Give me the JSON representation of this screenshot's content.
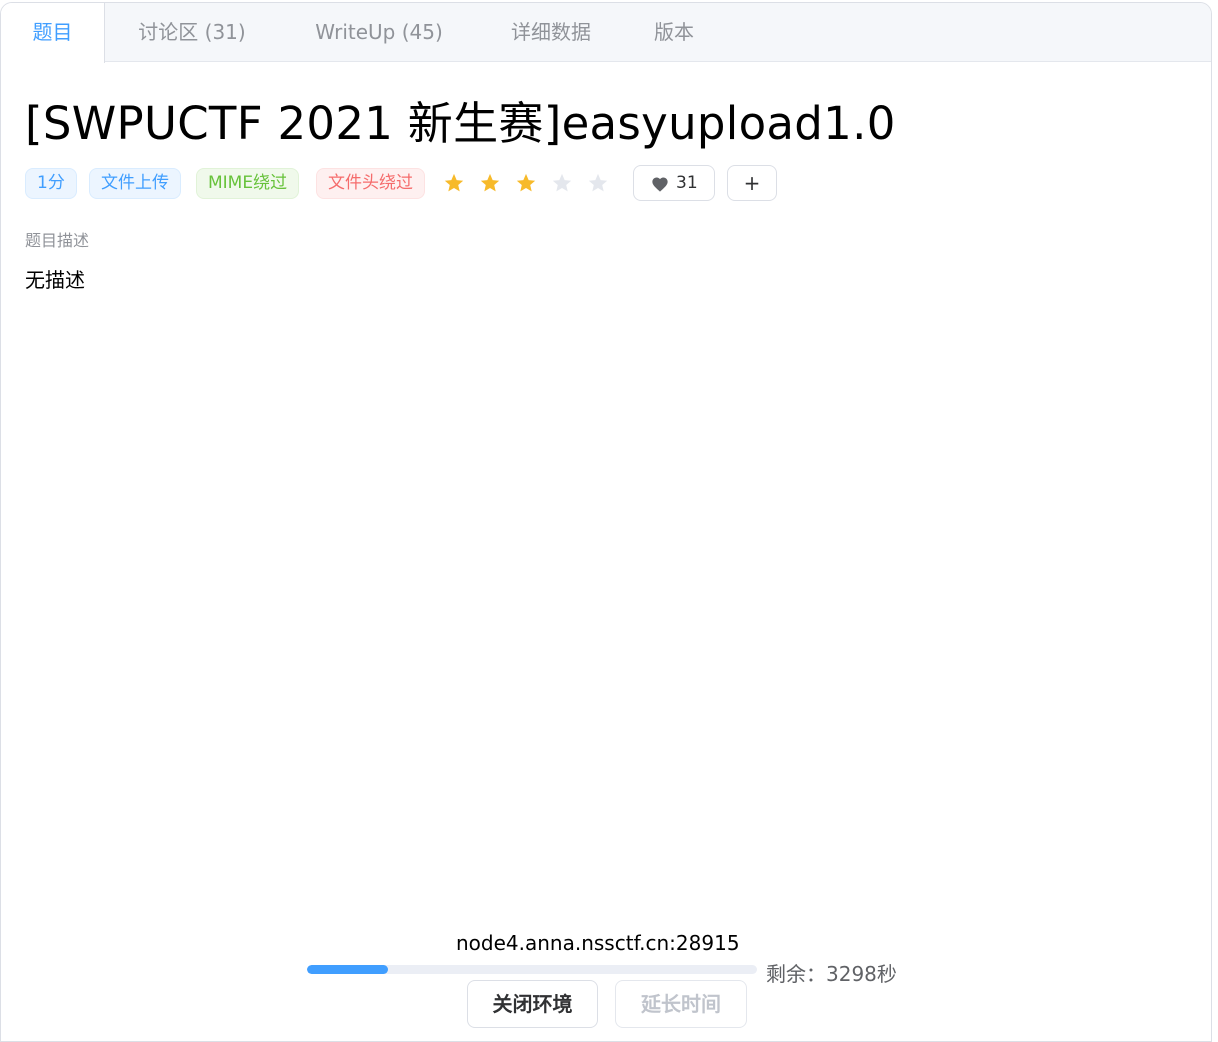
{
  "tabs": [
    {
      "label": "题目",
      "active": true
    },
    {
      "label": "讨论区 (31)",
      "active": false
    },
    {
      "label": "WriteUp (45)",
      "active": false
    },
    {
      "label": "详细数据",
      "active": false
    },
    {
      "label": "版本",
      "active": false
    }
  ],
  "problem": {
    "title": "[SWPUCTF 2021 新生赛]easyupload1.0",
    "tags": [
      {
        "label": "1分",
        "color": "#409eff"
      },
      {
        "label": "文件上传",
        "color": "#409eff"
      },
      {
        "label": "MIME绕过",
        "color": "#67c23a"
      },
      {
        "label": "文件头绕过",
        "color": "#f56c6c"
      }
    ],
    "rating": {
      "value": 3,
      "max": 5,
      "color": "#f7ba2a",
      "empty_color": "#e4e7ed"
    },
    "likes": "31",
    "add_label": "+",
    "description_label": "题目描述",
    "description": "无描述"
  },
  "environment": {
    "host": "node4.anna.nssctf.cn:28915",
    "progress_fraction": 0.18,
    "remaining": "剩余：3298秒",
    "close_label": "关闭环境",
    "extend_label": "延长时间"
  }
}
